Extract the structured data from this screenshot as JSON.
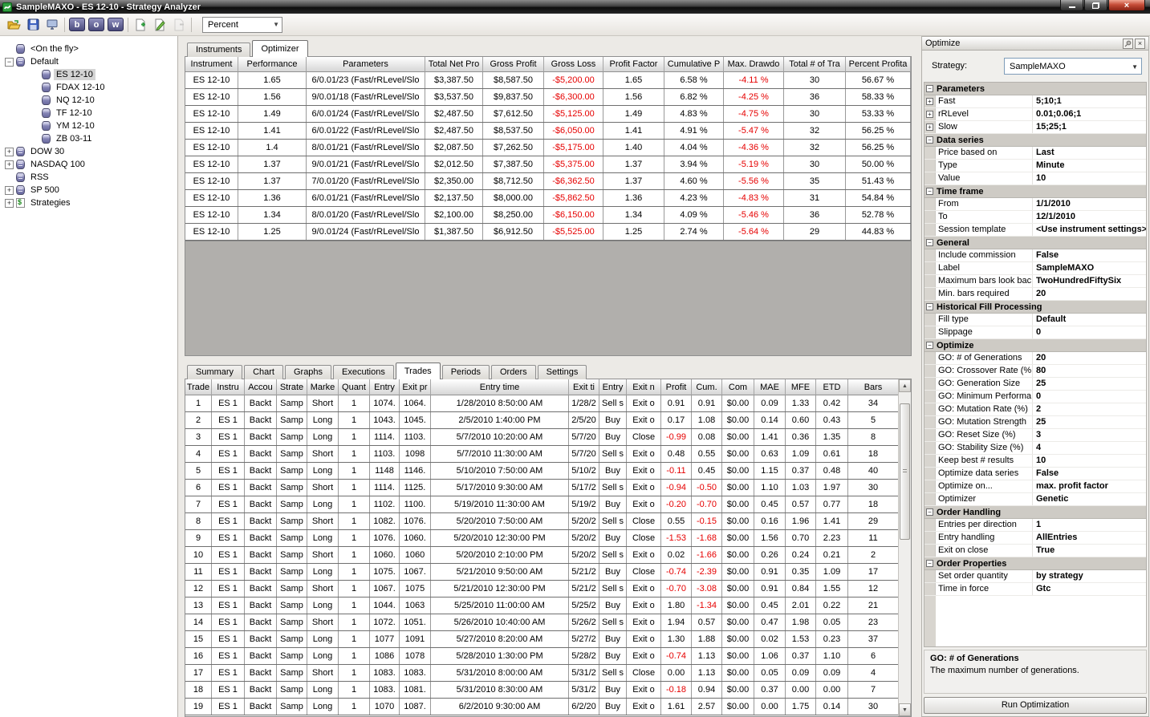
{
  "window": {
    "title": "SampleMAXO - ES 12-10 - Strategy Analyzer"
  },
  "glyphs": {
    "collapse": "−",
    "expand": "+",
    "dropdown_arrow": "▼",
    "scroll_up": "▲",
    "scroll_down": "▼",
    "close": "×",
    "pin": "✎"
  },
  "colors": {
    "negative_value": "#e60000",
    "app_brand_green": "#2f9e3f",
    "selection_gray": "#d4d4d4"
  },
  "toolbar": {
    "letter_buttons": [
      "b",
      "o",
      "w"
    ],
    "display_selector": "Percent"
  },
  "tree": {
    "items": [
      {
        "cls": "",
        "exp": "",
        "icon": "icon-db",
        "label": "<On the fly>"
      },
      {
        "cls": "",
        "exp": "−",
        "icon": "icon-dbs",
        "label": "Default"
      },
      {
        "cls": "child sel",
        "exp": "",
        "icon": "icon-db",
        "label": "ES 12-10"
      },
      {
        "cls": "child",
        "exp": "",
        "icon": "icon-db",
        "label": "FDAX 12-10"
      },
      {
        "cls": "child",
        "exp": "",
        "icon": "icon-db",
        "label": "NQ 12-10"
      },
      {
        "cls": "child",
        "exp": "",
        "icon": "icon-db",
        "label": "TF 12-10"
      },
      {
        "cls": "child",
        "exp": "",
        "icon": "icon-db",
        "label": "YM 12-10"
      },
      {
        "cls": "child",
        "exp": "",
        "icon": "icon-db",
        "label": "ZB 03-11"
      },
      {
        "cls": "",
        "exp": "+",
        "icon": "icon-dbs",
        "label": "DOW 30"
      },
      {
        "cls": "",
        "exp": "+",
        "icon": "icon-dbs",
        "label": "NASDAQ 100"
      },
      {
        "cls": "",
        "exp": "",
        "icon": "icon-dbs",
        "label": "RSS"
      },
      {
        "cls": "",
        "exp": "+",
        "icon": "icon-dbs",
        "label": "SP 500"
      },
      {
        "cls": "",
        "exp": "+",
        "icon": "icon-strat",
        "label": "Strategies"
      }
    ]
  },
  "top_tabs": [
    {
      "label": "Instruments",
      "cls": ""
    },
    {
      "label": "Optimizer",
      "cls": "active"
    }
  ],
  "optimizer_table": {
    "columns": [
      "Instrument",
      "Performance",
      "Parameters",
      "Total Net Pro",
      "Gross Profit",
      "Gross Loss",
      "Profit Factor",
      "Cumulative P",
      "Max. Drawdo",
      "Total # of Tra",
      "Percent Profita"
    ],
    "rows": [
      [
        "ES 12-10",
        "1.65",
        "6/0.01/23 (Fast/rRLevel/Slo",
        "$3,387.50",
        "$8,587.50",
        "-$5,200.00",
        "1.65",
        "6.58 %",
        "-4.11 %",
        "30",
        "56.67 %"
      ],
      [
        "ES 12-10",
        "1.56",
        "9/0.01/18 (Fast/rRLevel/Slo",
        "$3,537.50",
        "$9,837.50",
        "-$6,300.00",
        "1.56",
        "6.82 %",
        "-4.25 %",
        "36",
        "58.33 %"
      ],
      [
        "ES 12-10",
        "1.49",
        "6/0.01/24 (Fast/rRLevel/Slo",
        "$2,487.50",
        "$7,612.50",
        "-$5,125.00",
        "1.49",
        "4.83 %",
        "-4.75 %",
        "30",
        "53.33 %"
      ],
      [
        "ES 12-10",
        "1.41",
        "6/0.01/22 (Fast/rRLevel/Slo",
        "$2,487.50",
        "$8,537.50",
        "-$6,050.00",
        "1.41",
        "4.91 %",
        "-5.47 %",
        "32",
        "56.25 %"
      ],
      [
        "ES 12-10",
        "1.4",
        "8/0.01/21 (Fast/rRLevel/Slo",
        "$2,087.50",
        "$7,262.50",
        "-$5,175.00",
        "1.40",
        "4.04 %",
        "-4.36 %",
        "32",
        "56.25 %"
      ],
      [
        "ES 12-10",
        "1.37",
        "9/0.01/21 (Fast/rRLevel/Slo",
        "$2,012.50",
        "$7,387.50",
        "-$5,375.00",
        "1.37",
        "3.94 %",
        "-5.19 %",
        "30",
        "50.00 %"
      ],
      [
        "ES 12-10",
        "1.37",
        "7/0.01/20 (Fast/rRLevel/Slo",
        "$2,350.00",
        "$8,712.50",
        "-$6,362.50",
        "1.37",
        "4.60 %",
        "-5.56 %",
        "35",
        "51.43 %"
      ],
      [
        "ES 12-10",
        "1.36",
        "6/0.01/21 (Fast/rRLevel/Slo",
        "$2,137.50",
        "$8,000.00",
        "-$5,862.50",
        "1.36",
        "4.23 %",
        "-4.83 %",
        "31",
        "54.84 %"
      ],
      [
        "ES 12-10",
        "1.34",
        "8/0.01/20 (Fast/rRLevel/Slo",
        "$2,100.00",
        "$8,250.00",
        "-$6,150.00",
        "1.34",
        "4.09 %",
        "-5.46 %",
        "36",
        "52.78 %"
      ],
      [
        "ES 12-10",
        "1.25",
        "9/0.01/24 (Fast/rRLevel/Slo",
        "$1,387.50",
        "$6,912.50",
        "-$5,525.00",
        "1.25",
        "2.74 %",
        "-5.64 %",
        "29",
        "44.83 %"
      ]
    ]
  },
  "bottom_tabs": [
    {
      "label": "Summary",
      "cls": ""
    },
    {
      "label": "Chart",
      "cls": ""
    },
    {
      "label": "Graphs",
      "cls": ""
    },
    {
      "label": "Executions",
      "cls": ""
    },
    {
      "label": "Trades",
      "cls": "active"
    },
    {
      "label": "Periods",
      "cls": ""
    },
    {
      "label": "Orders",
      "cls": ""
    },
    {
      "label": "Settings",
      "cls": ""
    }
  ],
  "trades_table": {
    "columns": [
      "Trade",
      "Instru",
      "Accou",
      "Strate",
      "Marke",
      "Quant",
      "Entry",
      "Exit pr",
      "Entry time",
      "Exit ti",
      "Entry",
      "Exit n",
      "Profit",
      "Cum.",
      "Com",
      "MAE",
      "MFE",
      "ETD",
      "Bars"
    ],
    "rows": [
      [
        "1",
        "ES 1",
        "Backt",
        "Samp",
        "Short",
        "1",
        "1074.",
        "1064.",
        "1/28/2010 8:50:00 AM",
        "1/28/2",
        "Sell s",
        "Exit o",
        "0.91",
        "0.91",
        "$0.00",
        "0.09",
        "1.33",
        "0.42",
        "34"
      ],
      [
        "2",
        "ES 1",
        "Backt",
        "Samp",
        "Long",
        "1",
        "1043.",
        "1045.",
        "2/5/2010 1:40:00 PM",
        "2/5/20",
        "Buy",
        "Exit o",
        "0.17",
        "1.08",
        "$0.00",
        "0.14",
        "0.60",
        "0.43",
        "5"
      ],
      [
        "3",
        "ES 1",
        "Backt",
        "Samp",
        "Long",
        "1",
        "1114.",
        "1103.",
        "5/7/2010 10:20:00 AM",
        "5/7/20",
        "Buy",
        "Close",
        "-0.99",
        "0.08",
        "$0.00",
        "1.41",
        "0.36",
        "1.35",
        "8"
      ],
      [
        "4",
        "ES 1",
        "Backt",
        "Samp",
        "Short",
        "1",
        "1103.",
        "1098",
        "5/7/2010 11:30:00 AM",
        "5/7/20",
        "Sell s",
        "Exit o",
        "0.48",
        "0.55",
        "$0.00",
        "0.63",
        "1.09",
        "0.61",
        "18"
      ],
      [
        "5",
        "ES 1",
        "Backt",
        "Samp",
        "Long",
        "1",
        "1148",
        "1146.",
        "5/10/2010 7:50:00 AM",
        "5/10/2",
        "Buy",
        "Exit o",
        "-0.11",
        "0.45",
        "$0.00",
        "1.15",
        "0.37",
        "0.48",
        "40"
      ],
      [
        "6",
        "ES 1",
        "Backt",
        "Samp",
        "Short",
        "1",
        "1114.",
        "1125.",
        "5/17/2010 9:30:00 AM",
        "5/17/2",
        "Sell s",
        "Exit o",
        "-0.94",
        "-0.50",
        "$0.00",
        "1.10",
        "1.03",
        "1.97",
        "30"
      ],
      [
        "7",
        "ES 1",
        "Backt",
        "Samp",
        "Long",
        "1",
        "1102.",
        "1100.",
        "5/19/2010 11:30:00 AM",
        "5/19/2",
        "Buy",
        "Exit o",
        "-0.20",
        "-0.70",
        "$0.00",
        "0.45",
        "0.57",
        "0.77",
        "18"
      ],
      [
        "8",
        "ES 1",
        "Backt",
        "Samp",
        "Short",
        "1",
        "1082.",
        "1076.",
        "5/20/2010 7:50:00 AM",
        "5/20/2",
        "Sell s",
        "Close",
        "0.55",
        "-0.15",
        "$0.00",
        "0.16",
        "1.96",
        "1.41",
        "29"
      ],
      [
        "9",
        "ES 1",
        "Backt",
        "Samp",
        "Long",
        "1",
        "1076.",
        "1060.",
        "5/20/2010 12:30:00 PM",
        "5/20/2",
        "Buy",
        "Close",
        "-1.53",
        "-1.68",
        "$0.00",
        "1.56",
        "0.70",
        "2.23",
        "11"
      ],
      [
        "10",
        "ES 1",
        "Backt",
        "Samp",
        "Short",
        "1",
        "1060.",
        "1060",
        "5/20/2010 2:10:00 PM",
        "5/20/2",
        "Sell s",
        "Exit o",
        "0.02",
        "-1.66",
        "$0.00",
        "0.26",
        "0.24",
        "0.21",
        "2"
      ],
      [
        "11",
        "ES 1",
        "Backt",
        "Samp",
        "Long",
        "1",
        "1075.",
        "1067.",
        "5/21/2010 9:50:00 AM",
        "5/21/2",
        "Buy",
        "Close",
        "-0.74",
        "-2.39",
        "$0.00",
        "0.91",
        "0.35",
        "1.09",
        "17"
      ],
      [
        "12",
        "ES 1",
        "Backt",
        "Samp",
        "Short",
        "1",
        "1067.",
        "1075",
        "5/21/2010 12:30:00 PM",
        "5/21/2",
        "Sell s",
        "Exit o",
        "-0.70",
        "-3.08",
        "$0.00",
        "0.91",
        "0.84",
        "1.55",
        "12"
      ],
      [
        "13",
        "ES 1",
        "Backt",
        "Samp",
        "Long",
        "1",
        "1044.",
        "1063",
        "5/25/2010 11:00:00 AM",
        "5/25/2",
        "Buy",
        "Exit o",
        "1.80",
        "-1.34",
        "$0.00",
        "0.45",
        "2.01",
        "0.22",
        "21"
      ],
      [
        "14",
        "ES 1",
        "Backt",
        "Samp",
        "Short",
        "1",
        "1072.",
        "1051.",
        "5/26/2010 10:40:00 AM",
        "5/26/2",
        "Sell s",
        "Exit o",
        "1.94",
        "0.57",
        "$0.00",
        "0.47",
        "1.98",
        "0.05",
        "23"
      ],
      [
        "15",
        "ES 1",
        "Backt",
        "Samp",
        "Long",
        "1",
        "1077",
        "1091",
        "5/27/2010 8:20:00 AM",
        "5/27/2",
        "Buy",
        "Exit o",
        "1.30",
        "1.88",
        "$0.00",
        "0.02",
        "1.53",
        "0.23",
        "37"
      ],
      [
        "16",
        "ES 1",
        "Backt",
        "Samp",
        "Long",
        "1",
        "1086",
        "1078",
        "5/28/2010 1:30:00 PM",
        "5/28/2",
        "Buy",
        "Exit o",
        "-0.74",
        "1.13",
        "$0.00",
        "1.06",
        "0.37",
        "1.10",
        "6"
      ],
      [
        "17",
        "ES 1",
        "Backt",
        "Samp",
        "Short",
        "1",
        "1083.",
        "1083.",
        "5/31/2010 8:00:00 AM",
        "5/31/2",
        "Sell s",
        "Close",
        "0.00",
        "1.13",
        "$0.00",
        "0.05",
        "0.09",
        "0.09",
        "4"
      ],
      [
        "18",
        "ES 1",
        "Backt",
        "Samp",
        "Long",
        "1",
        "1083.",
        "1081.",
        "5/31/2010 8:30:00 AM",
        "5/31/2",
        "Buy",
        "Exit o",
        "-0.18",
        "0.94",
        "$0.00",
        "0.37",
        "0.00",
        "0.00",
        "7"
      ],
      [
        "19",
        "ES 1",
        "Backt",
        "Samp",
        "Long",
        "1",
        "1070",
        "1087.",
        "6/2/2010 9:30:00 AM",
        "6/2/20",
        "Buy",
        "Exit o",
        "1.61",
        "2.57",
        "$0.00",
        "0.00",
        "1.75",
        "0.14",
        "30"
      ]
    ]
  },
  "optimize_panel": {
    "title": "Optimize",
    "strategy_label": "Strategy:",
    "strategy_value": "SampleMAXO",
    "groups": [
      {
        "title": "Parameters",
        "rows": [
          {
            "exp": "+",
            "label": "Fast",
            "value": "5;10;1"
          },
          {
            "exp": "+",
            "label": "rRLevel",
            "value": "0.01;0.06;1"
          },
          {
            "exp": "+",
            "label": "Slow",
            "value": "15;25;1"
          }
        ]
      },
      {
        "title": "Data series",
        "rows": [
          {
            "label": "Price based on",
            "value": "Last"
          },
          {
            "label": "Type",
            "value": "Minute"
          },
          {
            "label": "Value",
            "value": "10"
          }
        ]
      },
      {
        "title": "Time frame",
        "rows": [
          {
            "label": "From",
            "value": "1/1/2010"
          },
          {
            "label": "To",
            "value": "12/1/2010"
          },
          {
            "label": "Session template",
            "value": "<Use instrument settings>"
          }
        ]
      },
      {
        "title": "General",
        "rows": [
          {
            "label": "Include commission",
            "value": "False"
          },
          {
            "label": "Label",
            "value": "SampleMAXO"
          },
          {
            "label": "Maximum bars look bac",
            "value": "TwoHundredFiftySix"
          },
          {
            "label": "Min. bars required",
            "value": "20"
          }
        ]
      },
      {
        "title": "Historical Fill Processing",
        "rows": [
          {
            "label": "Fill type",
            "value": "Default"
          },
          {
            "label": "Slippage",
            "value": "0"
          }
        ]
      },
      {
        "title": "Optimize",
        "rows": [
          {
            "label": "GO: # of Generations",
            "value": "20"
          },
          {
            "label": "GO: Crossover Rate (%",
            "value": "80"
          },
          {
            "label": "GO: Generation Size",
            "value": "25"
          },
          {
            "label": "GO: Minimum Performa",
            "value": "0"
          },
          {
            "label": "GO: Mutation Rate (%)",
            "value": "2"
          },
          {
            "label": "GO: Mutation Strength",
            "value": "25"
          },
          {
            "label": "GO: Reset Size (%)",
            "value": "3"
          },
          {
            "label": "GO: Stability Size (%)",
            "value": "4"
          },
          {
            "label": "Keep best # results",
            "value": "10"
          },
          {
            "label": "Optimize data series",
            "value": "False"
          },
          {
            "label": "Optimize on...",
            "value": "max. profit factor"
          },
          {
            "label": "Optimizer",
            "value": "Genetic"
          }
        ]
      },
      {
        "title": "Order Handling",
        "rows": [
          {
            "label": "Entries per direction",
            "value": "1"
          },
          {
            "label": "Entry handling",
            "value": "AllEntries"
          },
          {
            "label": "Exit on close",
            "value": "True"
          }
        ]
      },
      {
        "title": "Order Properties",
        "rows": [
          {
            "label": "Set order quantity",
            "value": "by strategy"
          },
          {
            "label": "Time in force",
            "value": "Gtc"
          }
        ]
      }
    ],
    "description_title": "GO: # of Generations",
    "description_text": "The maximum number of generations.",
    "run_button": "Run Optimization"
  }
}
